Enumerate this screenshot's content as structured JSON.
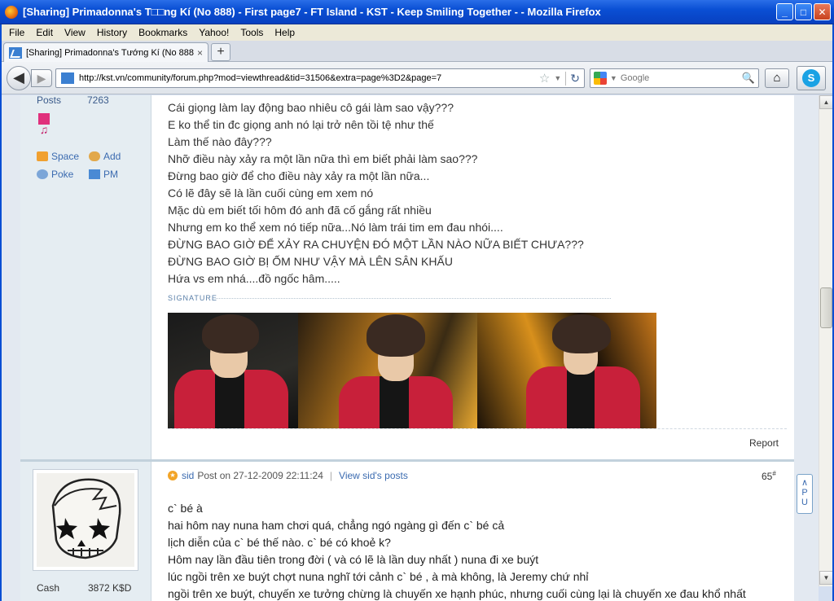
{
  "window": {
    "title": "[Sharing] Primadonna's T□□ng Kí (No 888) - First page7 - FT Island - KST - Keep Smiling Together - - Mozilla Firefox",
    "minimize": "_",
    "maximize": "□",
    "close": "✕"
  },
  "menu": [
    "File",
    "Edit",
    "View",
    "History",
    "Bookmarks",
    "Yahoo!",
    "Tools",
    "Help"
  ],
  "tab": {
    "label": "[Sharing] Primadonna's Tướng Kí (No 888) - ...",
    "close": "×",
    "new_tab": "+"
  },
  "nav": {
    "url": "http://kst.vn/community/forum.php?mod=viewthread&tid=31506&extra=page%3D2&page=7",
    "search_placeholder": "Google"
  },
  "post1": {
    "posts_label": "Posts",
    "posts_value": "7263",
    "badge_glyph": "♫",
    "actions": {
      "space": "Space",
      "add": "Add",
      "poke": "Poke",
      "pm": "PM"
    },
    "lines": [
      "Cái giọng làm lay động bao nhiêu cô gái làm sao vậy???",
      "E ko thể tin đc giọng anh nó lại trở nên tồi tệ như thế",
      "Làm thế nào đây???",
      "Nhỡ điều này xảy ra một lần nữa thì em biết phải làm sao???",
      "Đừng bao giờ để cho điều này xảy ra một lần nữa...",
      "Có lẽ đây sẽ là lần cuối cùng em xem nó",
      "Mặc dù em biết tối hôm đó anh đã cố gắng rất nhiều",
      "Nhưng em ko thể xem nó tiếp nữa...Nó làm trái tim em đau nhói....",
      "ĐỪNG BAO GIỜ ĐỂ XẢY RA CHUYỆN ĐÓ MỘT LẦN NÀO NỮA BIẾT CHƯA???",
      "ĐỪNG BAO GIỜ BỊ ỐM NHƯ VẬY MÀ LÊN SÂN KHẤU",
      "Hứa vs em nhá....đồ ngốc hâm....."
    ],
    "signature_label": "SIGNATURE",
    "report": "Report"
  },
  "post2": {
    "author": "sid",
    "posted_on": "Post on 27-12-2009 22:11:24",
    "view_posts": "View sid's posts",
    "floor": "65",
    "floor_sup": "#",
    "separator": "|",
    "lines": [
      "c` bé à",
      "hai hôm nay nuna ham chơi quá, chẳng ngó ngàng gì đến c` bé cả",
      "lịch diễn của c` bé thế nào. c` bé có khoẻ k?",
      "Hôm nay lần đầu tiên trong đời ( và có lẽ là lần duy nhất ) nuna đi xe buýt",
      "lúc ngồi trên xe buýt chợt nuna nghĩ tới cảnh c` bé , à mà không, là Jeremy chứ nhỉ",
      "ngồi trên xe buýt, chuyến xe tưởng chừng là chuyến xe hạnh phúc, nhưng cuối cùng lại là chuyến xe đau khổ nhất"
    ],
    "cash_label": "Cash",
    "cash_value": "3872 K$D"
  },
  "float_button": "∧\nP\nU",
  "colors": {
    "titlebar": "#0a4fd4",
    "link": "#3b6bb0",
    "sidebar": "#e5edf2",
    "jacket": "#c8203a"
  }
}
